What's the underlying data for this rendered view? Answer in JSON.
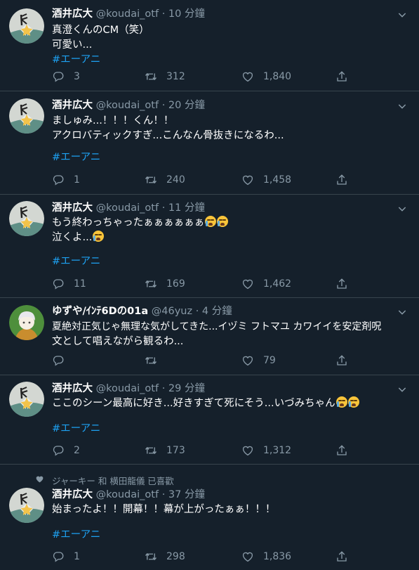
{
  "tweets": [
    {
      "name": "酒井広大",
      "handle": "@koudai_otf",
      "time": "10 分鐘",
      "lines": [
        "真澄くんのCM（笑）",
        "可愛い..."
      ],
      "hashtag": "#エーアニ",
      "replies": "3",
      "retweets": "312",
      "likes": "1,840"
    },
    {
      "name": "酒井広大",
      "handle": "@koudai_otf",
      "time": "20 分鐘",
      "lines": [
        "ましゅみ...！！！くん！！",
        "アクロバティックすぎ...こんなん骨抜きになるわ..."
      ],
      "hashtag": "#エーアニ",
      "replies": "1",
      "retweets": "240",
      "likes": "1,458"
    },
    {
      "name": "酒井広大",
      "handle": "@koudai_otf",
      "time": "11 分鐘",
      "lines": [
        "もう終わっちゃったぁぁぁぁぁぁ",
        "泣くよ..."
      ],
      "hashtag": "#エーアニ",
      "replies": "11",
      "retweets": "169",
      "likes": "1,462"
    },
    {
      "name": "ゆずや/ｲﾝﾃ6Dの01a",
      "handle": "@46yuz",
      "time": "4 分鐘",
      "lines": [
        "夏絶対正気じゃ無理な気がしてきた...イヅミ フトマユ カワイイを安定剤呪",
        "文として唱えながら観るわ..."
      ],
      "replies": "",
      "retweets": "",
      "likes": "79"
    },
    {
      "name": "酒井広大",
      "handle": "@koudai_otf",
      "time": "29 分鐘",
      "lines": [
        "ここのシーン最高に好き...好きすぎて死にそう...いづみちゃん"
      ],
      "hashtag": "#エーアニ",
      "replies": "2",
      "retweets": "173",
      "likes": "1,312"
    },
    {
      "social": "ジャーキー 和 横田龍儀 已喜歡",
      "name": "酒井広大",
      "handle": "@koudai_otf",
      "time": "37 分鐘",
      "lines": [
        "始まったよ！！開幕！！幕が上がったぁぁ！！！"
      ],
      "hashtag": "#エーアニ",
      "replies": "1",
      "retweets": "298",
      "likes": "1,836"
    }
  ],
  "separator": "·",
  "icons": [
    "chevron-down-icon",
    "reply-icon",
    "retweet-icon",
    "heart-icon",
    "share-icon"
  ],
  "colors": {
    "background": "#15202b",
    "muted": "#8899a6",
    "link": "#1da1f2",
    "border": "#38444d"
  }
}
